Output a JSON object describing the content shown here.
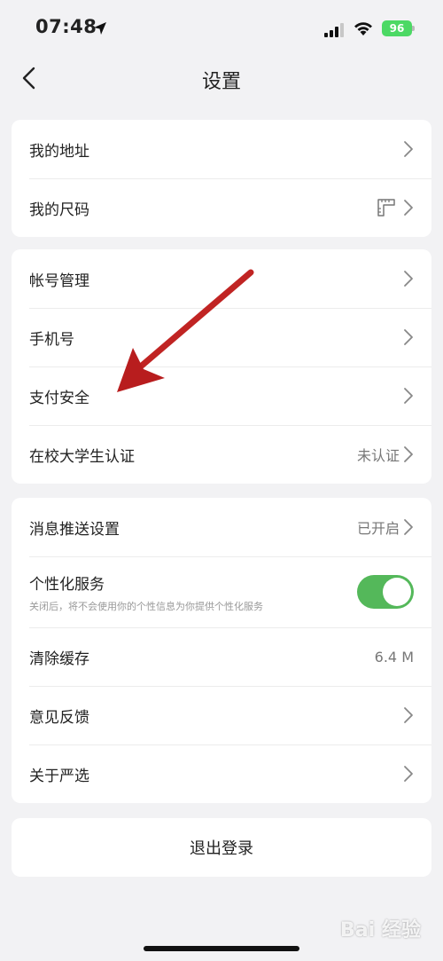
{
  "status_bar": {
    "time": "07:48",
    "battery": "96"
  },
  "nav": {
    "title": "设置"
  },
  "group1": {
    "items": [
      {
        "label": "我的地址"
      },
      {
        "label": "我的尺码"
      }
    ]
  },
  "group2": {
    "items": [
      {
        "label": "帐号管理"
      },
      {
        "label": "手机号"
      },
      {
        "label": "支付安全"
      },
      {
        "label": "在校大学生认证",
        "value": "未认证"
      }
    ]
  },
  "group3": {
    "items": [
      {
        "label": "消息推送设置",
        "value": "已开启"
      },
      {
        "label": "个性化服务",
        "sub": "关闭后，将不会使用你的个性信息为你提供个性化服务",
        "toggle_on": true
      },
      {
        "label": "清除缓存",
        "value": "6.4 M"
      },
      {
        "label": "意见反馈"
      },
      {
        "label": "关于严选"
      }
    ]
  },
  "logout": {
    "label": "退出登录"
  },
  "watermark": {
    "text": "Bai 经验"
  },
  "colors": {
    "toggle_on": "#54b85a",
    "battery": "#4cd964",
    "annotation_arrow": "#c0201e"
  },
  "icons": [
    "location-arrow-icon",
    "signal-icon",
    "wifi-icon",
    "back-chevron-icon",
    "chevron-right-icon",
    "ruler-icon"
  ]
}
